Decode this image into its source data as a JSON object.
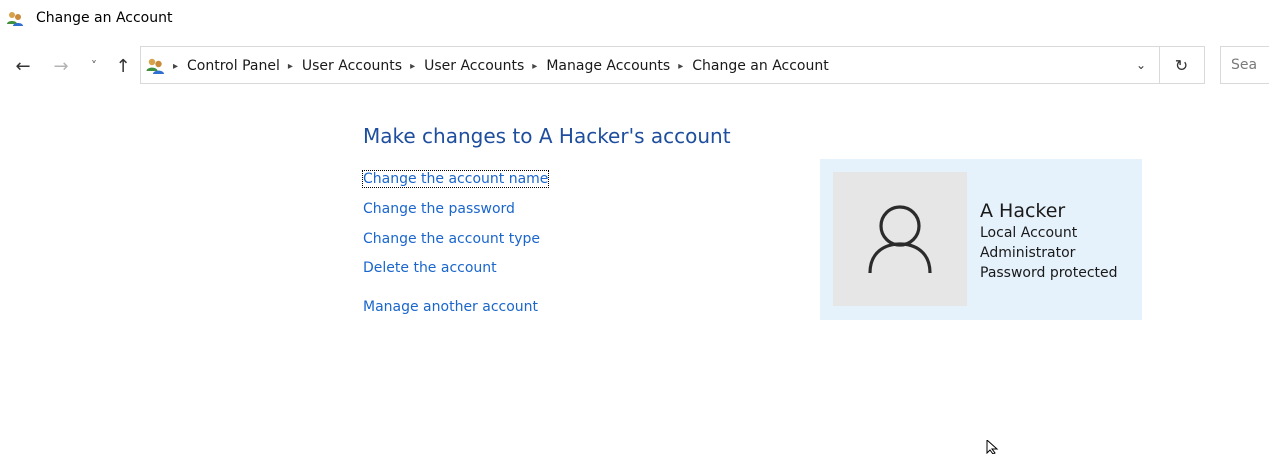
{
  "window": {
    "title": "Change an Account",
    "icon": "user-accounts-icon"
  },
  "navigation": {
    "back_icon": "arrow-left-icon",
    "forward_icon": "arrow-right-icon",
    "recent_icon": "chevron-down-icon",
    "up_icon": "arrow-up-icon",
    "breadcrumbs": [
      "Control Panel",
      "User Accounts",
      "User Accounts",
      "Manage Accounts",
      "Change an Account"
    ],
    "search_placeholder": "Search Control Panel",
    "search_visible_text": "Sea"
  },
  "main": {
    "heading": "Make changes to A Hacker's account",
    "links": [
      "Change the account name",
      "Change the password",
      "Change the account type",
      "Delete the account",
      "Manage another account"
    ]
  },
  "account_card": {
    "name": "A Hacker",
    "details": [
      "Local Account",
      "Administrator",
      "Password protected"
    ],
    "avatar_icon": "user-silhouette-icon"
  },
  "colors": {
    "heading": "#1e4e9d",
    "link": "#1a66cc",
    "card_background": "#e5f1fb",
    "avatar_background": "#e6e6e6"
  }
}
